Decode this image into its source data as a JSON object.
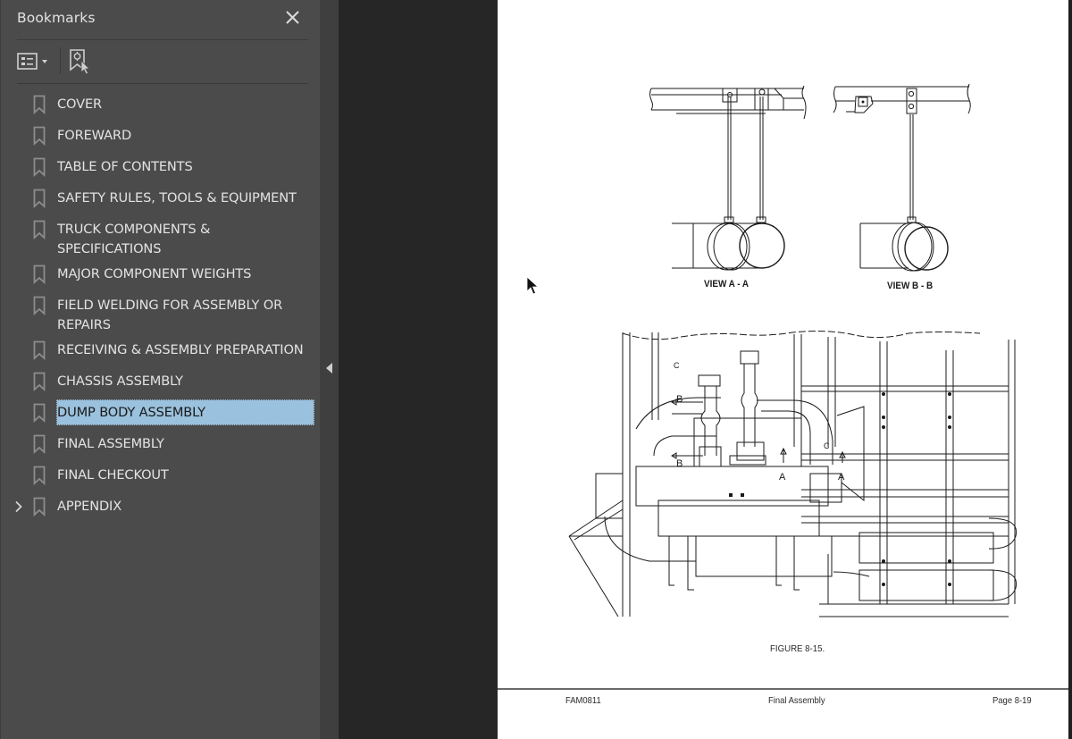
{
  "bookmarks_panel": {
    "title": "Bookmarks",
    "close_icon": "close-icon",
    "options_icon": "list-options-icon",
    "find_icon": "find-current-bookmark-icon",
    "selected_color": "#9ac1dd",
    "items": [
      {
        "label": "COVER",
        "expandable": false,
        "selected": false
      },
      {
        "label": "FOREWARD",
        "expandable": false,
        "selected": false
      },
      {
        "label": "TABLE OF CONTENTS",
        "expandable": false,
        "selected": false
      },
      {
        "label": "SAFETY RULES, TOOLS & EQUIPMENT",
        "expandable": false,
        "selected": false
      },
      {
        "label": "TRUCK COMPONENTS & SPECIFICATIONS",
        "expandable": false,
        "selected": false
      },
      {
        "label": "MAJOR COMPONENT WEIGHTS",
        "expandable": false,
        "selected": false
      },
      {
        "label": "FIELD WELDING FOR ASSEMBLY OR REPAIRS",
        "expandable": false,
        "selected": false
      },
      {
        "label": "RECEIVING & ASSEMBLY PREPARATION",
        "expandable": false,
        "selected": false
      },
      {
        "label": "CHASSIS ASSEMBLY",
        "expandable": false,
        "selected": false
      },
      {
        "label": "DUMP BODY ASSEMBLY",
        "expandable": false,
        "selected": true
      },
      {
        "label": "FINAL ASSEMBLY",
        "expandable": false,
        "selected": false
      },
      {
        "label": "FINAL CHECKOUT",
        "expandable": false,
        "selected": false
      },
      {
        "label": "APPENDIX",
        "expandable": true,
        "selected": false
      }
    ]
  },
  "document": {
    "view_a_label": "VIEW A - A",
    "view_b_label": "VIEW  B - B",
    "drawing_callouts": {
      "b": "B",
      "a": "A",
      "c": "C"
    },
    "figure_caption": "FIGURE 8-15.",
    "footer": {
      "doc_code": "FAM0811",
      "section": "Final Assembly",
      "page": "Page 8-19"
    }
  }
}
